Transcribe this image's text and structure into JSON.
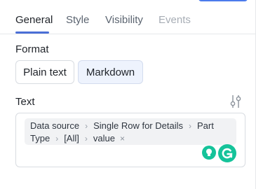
{
  "tabs": [
    {
      "label": "General"
    },
    {
      "label": "Style"
    },
    {
      "label": "Visibility"
    },
    {
      "label": "Events"
    }
  ],
  "format": {
    "label": "Format",
    "options": [
      "Plain text",
      "Markdown"
    ],
    "selected": "Markdown"
  },
  "text": {
    "label": "Text",
    "path_line1": [
      "Data source",
      "Single Row for Details",
      "Part"
    ],
    "path_line2": [
      "Type",
      "[All]",
      "value"
    ],
    "remove_glyph": "×",
    "separator_glyph": "›"
  },
  "colors": {
    "accent": "#4b6fd6",
    "selected_bg": "#eef3fd",
    "grammarly_green": "#15c39a"
  },
  "icons": {
    "settings": "sliders-icon",
    "hint": "lightbulb-icon",
    "grammarly": "grammarly-icon"
  }
}
